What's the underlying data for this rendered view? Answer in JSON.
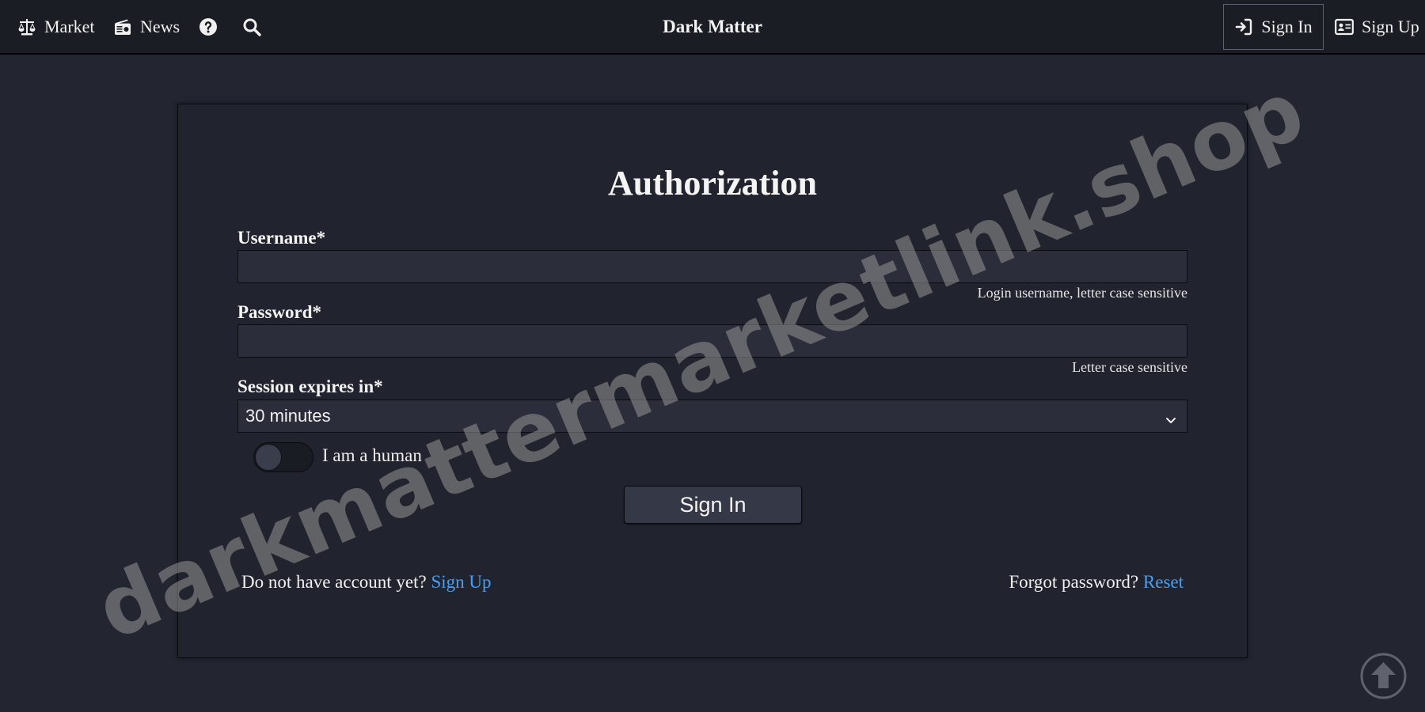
{
  "navbar": {
    "market_label": "Market",
    "news_label": "News",
    "brand": "Dark Matter",
    "signin_label": "Sign In",
    "signup_label": "Sign Up",
    "icons": {
      "market": "scales-icon",
      "news": "radio-icon",
      "help": "question-circle-icon",
      "search": "search-icon",
      "signin": "sign-in-icon",
      "signup": "id-card-icon"
    }
  },
  "form": {
    "title": "Authorization",
    "username_label": "Username*",
    "username_value": "",
    "username_hint": "Login username, letter case sensitive",
    "password_label": "Password*",
    "password_value": "",
    "password_hint": "Letter case sensitive",
    "session_label": "Session expires in*",
    "session_selected": "30 minutes",
    "human_toggle_label": "I am a human",
    "human_toggle_on": false,
    "submit_label": "Sign In",
    "no_account_text": "Do not have account yet?",
    "signup_link": "Sign Up",
    "forgot_text": "Forgot password?",
    "reset_link": "Reset"
  },
  "watermark": "darkmattermarketlink.shop",
  "colors": {
    "background": "#232631",
    "navbar": "#1b1d24",
    "link": "#4a9df0"
  }
}
